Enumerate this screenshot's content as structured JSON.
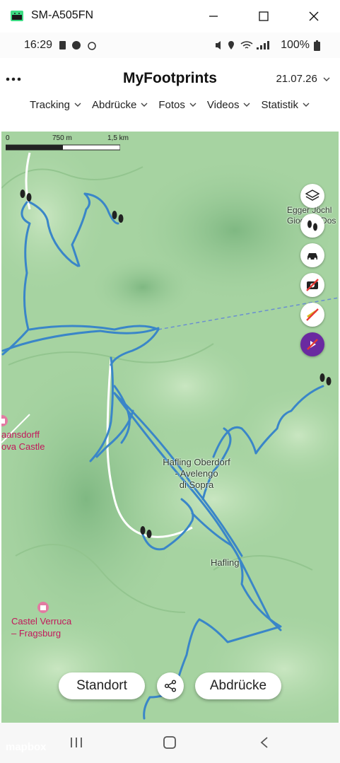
{
  "window": {
    "title": "SM-A505FN",
    "controls": [
      "minimize-icon",
      "maximize-icon",
      "close-icon"
    ]
  },
  "status_bar": {
    "time": "16:29",
    "left_icons": [
      "sim-icon",
      "message-icon",
      "alarm-icon"
    ],
    "right_icons": [
      "mute-icon",
      "location-icon",
      "wifi-icon",
      "signal-icon"
    ],
    "battery": "100%"
  },
  "app": {
    "title": "MyFootprints",
    "menu_icon": "more-dots-icon",
    "date": "21.07.26"
  },
  "tabs": [
    {
      "label": "Tracking"
    },
    {
      "label": "Abdrücke"
    },
    {
      "label": "Fotos"
    },
    {
      "label": "Videos"
    },
    {
      "label": "Statistik"
    }
  ],
  "map": {
    "scale": {
      "zero": "0",
      "mid": "750 m",
      "max": "1,5 km"
    },
    "labels": {
      "hafling_oberdorf": "Hafling Oberdorf\n- Avelengo\ndi Sopra",
      "hafling": "Hafling",
      "egger_joechl": "Egger Jöchl\nGiogo di Dos",
      "castel_verruca": "Castel Verruca\n– Fragsburg",
      "maansdorff": "aansdorff\nova Castle"
    },
    "track_color": "#3a86c8",
    "route_color": "#6a8fd0",
    "controls": [
      "layers-icon",
      "footprints-icon",
      "car-icon",
      "no-photo-icon",
      "no-route-icon",
      "no-video-icon"
    ],
    "attribution": "mapbox"
  },
  "actions": {
    "standort": "Standort",
    "abdruecke": "Abdrücke",
    "share_icon": "share-icon"
  },
  "nav": [
    "recents-icon",
    "home-icon",
    "back-icon"
  ]
}
